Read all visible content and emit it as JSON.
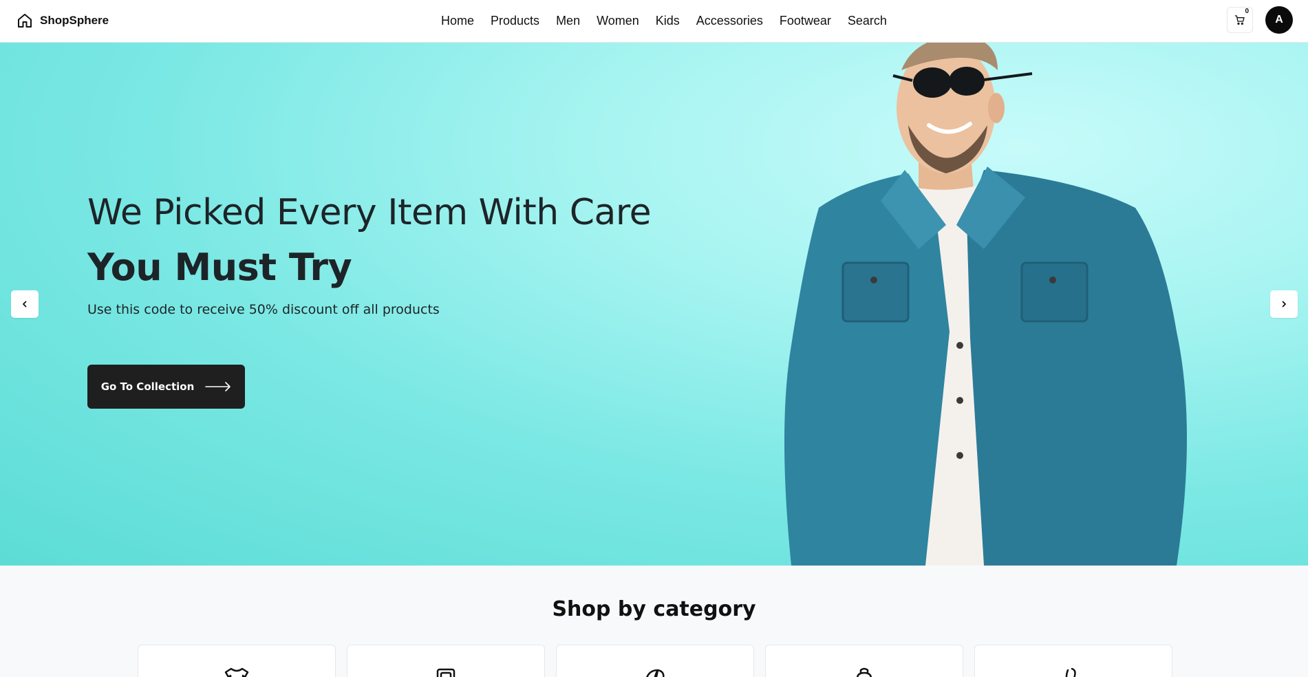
{
  "header": {
    "brand": "ShopSphere",
    "nav": [
      "Home",
      "Products",
      "Men",
      "Women",
      "Kids",
      "Accessories",
      "Footwear",
      "Search"
    ],
    "cart_count": "0",
    "avatar_initial": "A"
  },
  "hero": {
    "line1": "We Picked Every Item With Care",
    "line2": "You Must Try",
    "subtitle": "Use this code to receive 50% discount off all products",
    "button_label": "Go To Collection"
  },
  "category": {
    "title": "Shop by category",
    "icons": [
      "shirt-icon",
      "camera-icon",
      "hat-icon",
      "backpack-icon",
      "shoe-icon"
    ]
  },
  "colors": {
    "hero_bg": "#7be8e4",
    "button_bg": "#1f1f1f",
    "text_dark": "#1d2428"
  }
}
